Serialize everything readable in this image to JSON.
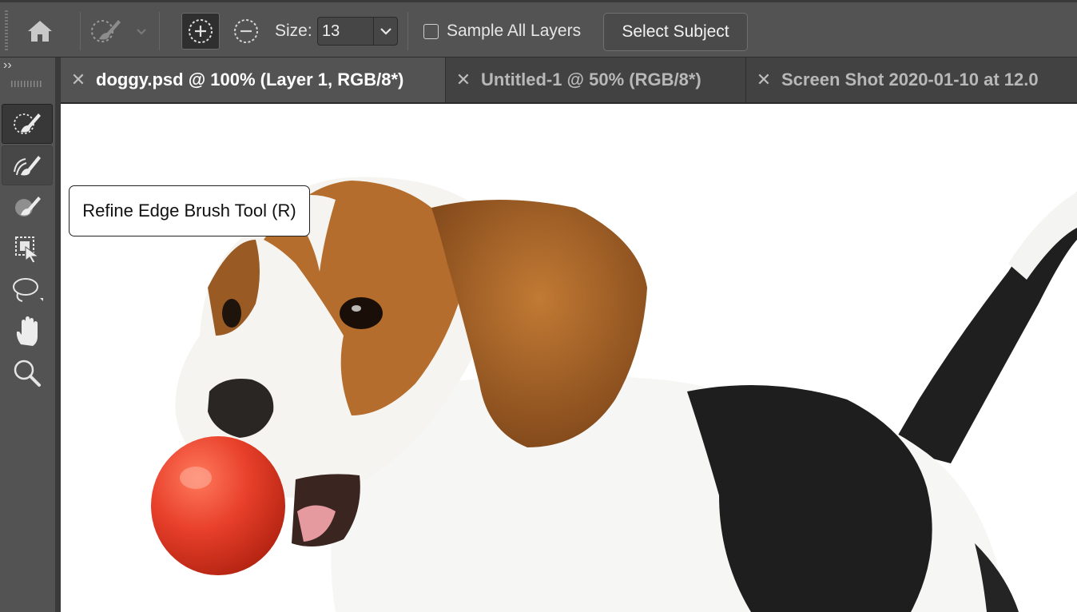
{
  "options_bar": {
    "home_icon": "home-icon",
    "preset_icon": "quick-selection-brush-icon",
    "add_mode_icon": "add-to-selection-icon",
    "subtract_mode_icon": "subtract-from-selection-icon",
    "size_label": "Size:",
    "size_value": "13",
    "sample_all_layers_label": "Sample All Layers",
    "sample_all_layers_checked": false,
    "select_subject_label": "Select Subject"
  },
  "toolbar": {
    "collapse_label": "››",
    "tools": [
      {
        "name": "quick-selection-tool",
        "icon": "quick-selection-brush-icon",
        "state": "active"
      },
      {
        "name": "refine-edge-brush-tool",
        "icon": "refine-edge-brush-icon",
        "state": "hover"
      },
      {
        "name": "brush-tool",
        "icon": "brush-icon",
        "state": "normal"
      },
      {
        "name": "object-selection-tool",
        "icon": "object-selection-icon",
        "state": "normal"
      },
      {
        "name": "lasso-tool",
        "icon": "lasso-icon",
        "state": "normal"
      },
      {
        "name": "hand-tool",
        "icon": "hand-icon",
        "state": "normal"
      },
      {
        "name": "zoom-tool",
        "icon": "zoom-icon",
        "state": "normal"
      }
    ]
  },
  "tabs": [
    {
      "label": "doggy.psd @ 100% (Layer 1, RGB/8*)",
      "active": true
    },
    {
      "label": "Untitled-1 @ 50% (RGB/8*)",
      "active": false
    },
    {
      "label": "Screen Shot 2020-01-10 at 12.0",
      "active": false
    }
  ],
  "tooltip": {
    "text": "Refine Edge Brush Tool (R)"
  },
  "canvas": {
    "content": "beagle-with-red-ball-image"
  },
  "colors": {
    "ui_background": "#535353",
    "tab_bar": "#424242",
    "canvas": "#ffffff",
    "ball_red": "#e8402b"
  }
}
